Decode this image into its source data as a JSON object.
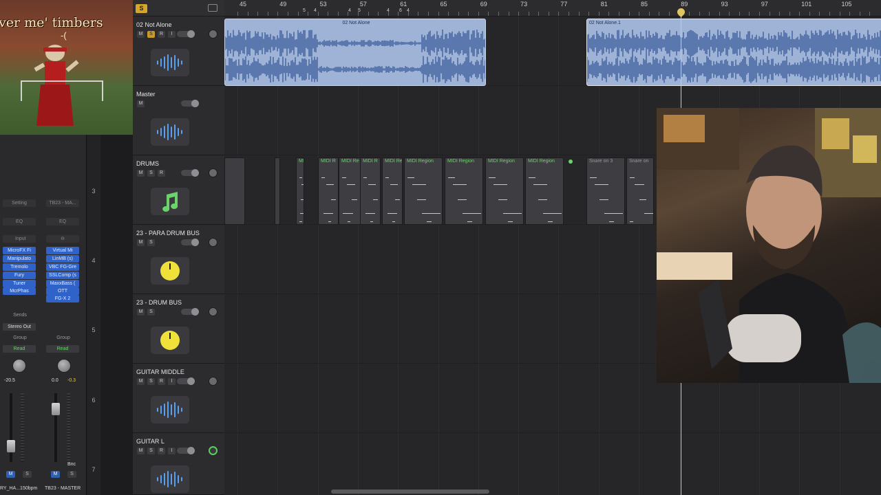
{
  "overlay": {
    "caption": "ver me' timbers",
    "subcaption": "-("
  },
  "mixer": {
    "strip1": {
      "setting": "Setting",
      "eq": "EQ",
      "input": "Input",
      "plugins": [
        "MicroFX Fi",
        "Manipulato",
        "Tremolo",
        "Fury",
        "Tuner",
        "McrPhas"
      ],
      "sends": "Sends",
      "output": "Stereo Out",
      "group": "Group",
      "automation": "Read",
      "pan_value": "-20.5",
      "mute": "M",
      "solo": "S",
      "name": "RY_HA...150bpm"
    },
    "strip2": {
      "setting": "TB23 - MA...",
      "eq": "EQ",
      "plugins": [
        "Virtual Mi",
        "LinMB (s)",
        "VBC FG-Gre",
        "SSLComp (s",
        "MaxxBass (",
        "OTT",
        "FG-X 2"
      ],
      "group": "Group",
      "automation": "Read",
      "pan_value": "0.0",
      "peak_value": "-0.3",
      "bounce": "Bnc",
      "mute": "M",
      "solo": "S",
      "name": "TB23 - MASTER"
    }
  },
  "track_numbers": [
    "3",
    "4",
    "5",
    "6",
    "7"
  ],
  "header": {
    "snap_label": "S"
  },
  "tracks": [
    {
      "name": "02 Not Alone",
      "buttons": [
        "M",
        "S",
        "R",
        "I"
      ],
      "icon": "waveform-icon"
    },
    {
      "name": "Master",
      "buttons": [
        "M"
      ],
      "icon": "waveform-icon"
    },
    {
      "name": "DRUMS",
      "buttons": [
        "M",
        "S",
        "R"
      ],
      "icon": "music-note-icon"
    },
    {
      "name": "23 - PARA DRUM BUS",
      "buttons": [
        "M",
        "S"
      ],
      "icon": "yellow-knob-icon"
    },
    {
      "name": "23 - DRUM BUS",
      "buttons": [
        "M",
        "S"
      ],
      "icon": "yellow-knob-icon"
    },
    {
      "name": "GUITAR MIDDLE",
      "buttons": [
        "M",
        "S",
        "R",
        "I"
      ],
      "icon": "waveform-icon"
    },
    {
      "name": "GUITAR L",
      "buttons": [
        "M",
        "S",
        "R",
        "I"
      ],
      "icon": "waveform-icon"
    }
  ],
  "ruler": {
    "bars": [
      "45",
      "49",
      "53",
      "57",
      "61",
      "65",
      "69",
      "73",
      "77",
      "81",
      "85",
      "89",
      "93",
      "97",
      "101",
      "105"
    ],
    "markers": [
      "5",
      "4",
      "4",
      "5",
      "4",
      "6",
      "4"
    ]
  },
  "audio_regions": [
    {
      "title": "02 Not Alone"
    },
    {
      "title": "02 Not Alone.1"
    }
  ],
  "midi_regions": [
    "MI",
    "MIDI R",
    "MIDI Re",
    "MIDI R",
    "MIDI Re",
    "MIDI Region",
    "MIDI Region",
    "MIDI Region",
    "MIDI Region",
    "Snare on 3",
    "Snare on"
  ],
  "colors": {
    "accent_yellow": "#d4a72c",
    "region_blue": "#9eb3d6",
    "midi_green": "#6ad46a",
    "playhead": "#e4d36a"
  }
}
